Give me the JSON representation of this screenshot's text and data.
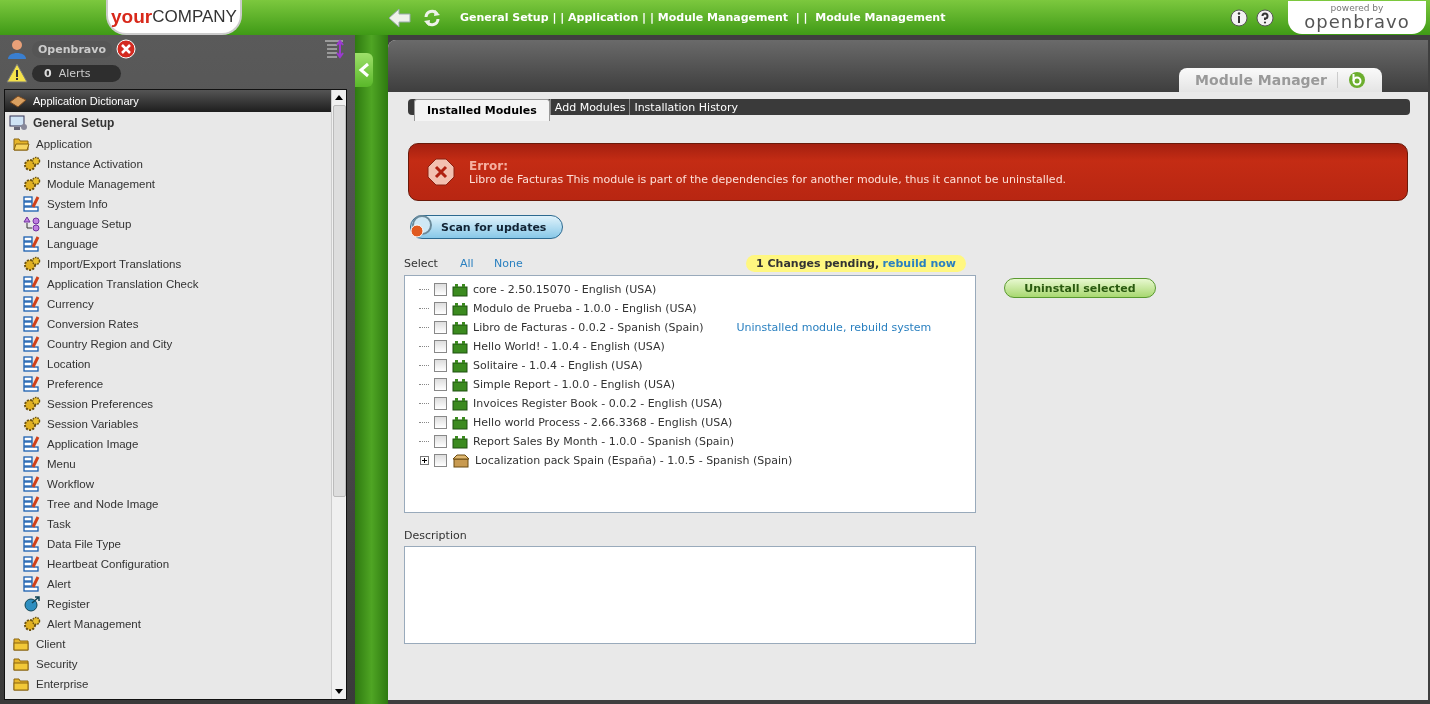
{
  "header": {
    "logo_bold": "your",
    "logo_rest": "COMPANY",
    "breadcrumb": "General Setup | | Application | | Module Management  | |  Module Management",
    "powered_by": "powered by",
    "brand": "openbravo"
  },
  "user": {
    "name": "Openbravo",
    "alert_count": "0",
    "alert_label": "Alerts"
  },
  "menu": [
    {
      "label": "Application Dictionary",
      "kind": "dictionary",
      "selected": true
    },
    {
      "label": "General Setup",
      "kind": "setup",
      "selected": false,
      "children": [
        {
          "label": "Application",
          "expanded": true,
          "children": [
            {
              "label": "Instance Activation",
              "kind": "process"
            },
            {
              "label": "Module Management",
              "kind": "process"
            },
            {
              "label": "System Info",
              "kind": "window"
            },
            {
              "label": "Language Setup",
              "kind": "workflow"
            },
            {
              "label": "Language",
              "kind": "window"
            },
            {
              "label": "Import/Export Translations",
              "kind": "process"
            },
            {
              "label": "Application Translation Check",
              "kind": "window"
            },
            {
              "label": "Currency",
              "kind": "window"
            },
            {
              "label": "Conversion Rates",
              "kind": "window"
            },
            {
              "label": "Country Region and City",
              "kind": "window"
            },
            {
              "label": "Location",
              "kind": "window"
            },
            {
              "label": "Preference",
              "kind": "window"
            },
            {
              "label": "Session Preferences",
              "kind": "process"
            },
            {
              "label": "Session Variables",
              "kind": "process"
            },
            {
              "label": "Application Image",
              "kind": "window"
            },
            {
              "label": "Menu",
              "kind": "window"
            },
            {
              "label": "Workflow",
              "kind": "window"
            },
            {
              "label": "Tree and Node Image",
              "kind": "window"
            },
            {
              "label": "Task",
              "kind": "window"
            },
            {
              "label": "Data File Type",
              "kind": "window"
            },
            {
              "label": "Heartbeat Configuration",
              "kind": "window"
            },
            {
              "label": "Alert",
              "kind": "window"
            },
            {
              "label": "Register",
              "kind": "external"
            },
            {
              "label": "Alert Management",
              "kind": "process"
            }
          ]
        },
        {
          "label": "Client",
          "expanded": false
        },
        {
          "label": "Security",
          "expanded": false
        },
        {
          "label": "Enterprise",
          "expanded": false
        }
      ]
    }
  ],
  "window_tab": "Module Manager",
  "tabs": [
    {
      "label": "Installed Modules",
      "selected": true
    },
    {
      "label": "Add Modules",
      "selected": false
    },
    {
      "label": "Installation History",
      "selected": false
    }
  ],
  "error": {
    "title": "Error:",
    "message": "Libro de Facturas This module is part of the dependencies for another module, thus it cannot be uninstalled."
  },
  "scan_button": "Scan for updates",
  "select": {
    "label": "Select",
    "all": "All",
    "none": "None"
  },
  "pending": {
    "text": "1 Changes pending,",
    "link": "rebuild now"
  },
  "modules": [
    {
      "label": "core - 2.50.15070 - English (USA)",
      "kind": "module",
      "checked": false
    },
    {
      "label": "Modulo de Prueba - 1.0.0 - English (USA)",
      "kind": "module",
      "checked": false
    },
    {
      "label": "Libro de Facturas - 0.0.2 - Spanish (Spain)",
      "kind": "module",
      "checked": false,
      "note": "Uninstalled module, rebuild system"
    },
    {
      "label": "Hello World! - 1.0.4 - English (USA)",
      "kind": "module",
      "checked": false
    },
    {
      "label": "Solitaire - 1.0.4 - English (USA)",
      "kind": "module",
      "checked": false
    },
    {
      "label": "Simple Report - 1.0.0 - English (USA)",
      "kind": "module",
      "checked": false
    },
    {
      "label": "Invoices Register Book - 0.0.2 - English (USA)",
      "kind": "module",
      "checked": false
    },
    {
      "label": "Hello world Process - 2.66.3368 - English (USA)",
      "kind": "module",
      "checked": false
    },
    {
      "label": "Report Sales By Month - 1.0.0 - Spanish (Spain)",
      "kind": "module",
      "checked": false
    },
    {
      "label": "Localization pack Spain (España) - 1.0.5 - Spanish (Spain)",
      "kind": "pack",
      "checked": false,
      "expanded": false
    }
  ],
  "uninstall_button": "Uninstall selected",
  "description_label": "Description"
}
